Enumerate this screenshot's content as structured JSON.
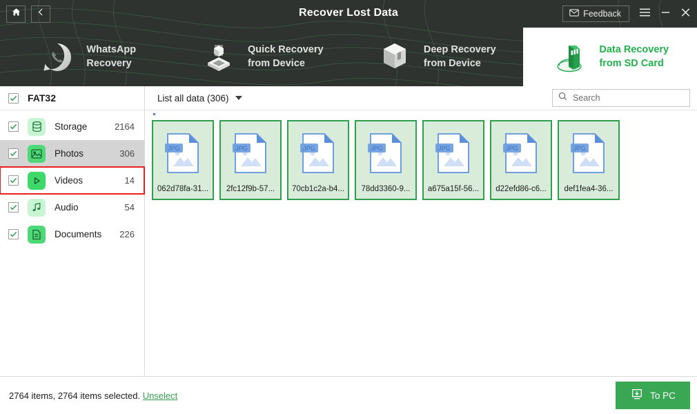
{
  "window": {
    "title": "Recover Lost Data",
    "home_icon": "home-icon",
    "back_icon": "back-arrow-icon",
    "feedback_label": "Feedback",
    "feedback_icon": "envelope-icon",
    "menu_icon": "hamburger-menu-icon",
    "minimize_icon": "minimize-icon",
    "close_icon": "close-icon"
  },
  "tabs": [
    {
      "label": "WhatsApp\nRecovery",
      "icon": "whatsapp-recovery-icon",
      "active": false
    },
    {
      "label": "Quick Recovery\nfrom Device",
      "icon": "quick-recovery-device-icon",
      "active": false
    },
    {
      "label": "Deep Recovery\nfrom Device",
      "icon": "deep-recovery-device-icon",
      "active": false
    },
    {
      "label": "Data Recovery\nfrom SD Card",
      "icon": "sd-card-recovery-icon",
      "active": true
    }
  ],
  "sidebar": {
    "drive_label": "FAT32",
    "drive_checked": true,
    "items": [
      {
        "label": "Storage",
        "count": "2164",
        "icon": "storage-database-icon",
        "checked": true,
        "selected": false,
        "highlighted": false
      },
      {
        "label": "Photos",
        "count": "306",
        "icon": "photos-image-icon",
        "checked": true,
        "selected": true,
        "highlighted": false
      },
      {
        "label": "Videos",
        "count": "14",
        "icon": "videos-play-icon",
        "checked": true,
        "selected": false,
        "highlighted": true
      },
      {
        "label": "Audio",
        "count": "54",
        "icon": "audio-music-note-icon",
        "checked": true,
        "selected": false,
        "highlighted": false
      },
      {
        "label": "Documents",
        "count": "226",
        "icon": "documents-file-icon",
        "checked": true,
        "selected": false,
        "highlighted": false
      }
    ]
  },
  "toolbar": {
    "list_all_label": "List all data (306)",
    "dropdown_icon": "chevron-down-icon",
    "search_placeholder": "Search",
    "search_value": "",
    "search_icon": "search-icon"
  },
  "files": [
    {
      "name": "062d78fa-31...",
      "icon": "image-file-icon",
      "selected": true
    },
    {
      "name": "2fc12f9b-57...",
      "icon": "image-file-icon",
      "selected": true
    },
    {
      "name": "70cb1c2a-b4...",
      "icon": "image-file-icon",
      "selected": true
    },
    {
      "name": "78dd3360-9...",
      "icon": "image-file-icon",
      "selected": true
    },
    {
      "name": "a675a15f-56...",
      "icon": "image-file-icon",
      "selected": true
    },
    {
      "name": "d22efd86-c6...",
      "icon": "image-file-icon",
      "selected": true
    },
    {
      "name": "def1fea4-36...",
      "icon": "image-file-icon",
      "selected": true
    }
  ],
  "footer": {
    "status_text": "2764 items, 2764 items selected.",
    "unselect_label": "Unselect",
    "topc_label": "To PC",
    "topc_icon": "download-to-pc-icon"
  },
  "colors": {
    "header_bg": "#2e332f",
    "accent_green": "#21b24b",
    "button_green": "#3aa755",
    "file_border": "#2f9e4f",
    "file_bg": "#d8ecd9",
    "highlight_red": "#e81f1f",
    "row_selected": "#d4d4d4"
  }
}
